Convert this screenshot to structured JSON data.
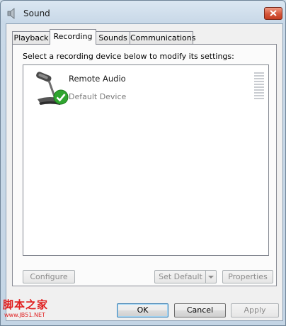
{
  "window": {
    "title": "Sound",
    "title_icon": "speaker-icon",
    "close_icon": "close-icon"
  },
  "tabs": [
    {
      "label": "Playback",
      "active": false
    },
    {
      "label": "Recording",
      "active": true
    },
    {
      "label": "Sounds",
      "active": false
    },
    {
      "label": "Communications",
      "active": false
    }
  ],
  "recording": {
    "instruction": "Select a recording device below to modify its settings:",
    "devices": [
      {
        "name": "Remote Audio",
        "status": "Default Device",
        "icon": "microphone-icon",
        "badge_icon": "green-check-icon",
        "level": 0
      }
    ],
    "configure_label": "Configure",
    "set_default_label": "Set Default",
    "properties_label": "Properties"
  },
  "footer": {
    "ok_label": "OK",
    "cancel_label": "Cancel",
    "apply_label": "Apply"
  },
  "watermark": {
    "text": "脚本之家",
    "url": "www.JB51.NET"
  },
  "colors": {
    "watermark": "#e02020",
    "check_badge": "#2fa52f",
    "default_button_border": "#3c7fb1"
  }
}
